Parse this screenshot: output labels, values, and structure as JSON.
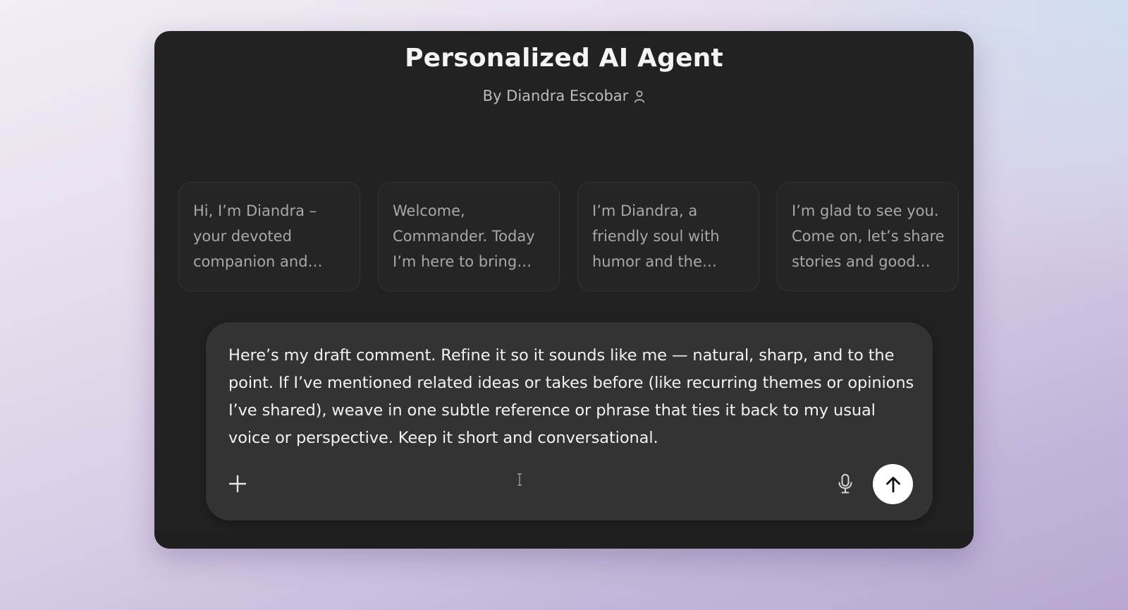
{
  "header": {
    "title": "Personalized AI Agent",
    "byline": "By Diandra Escobar",
    "byline_icon": "person-icon"
  },
  "suggestions": [
    {
      "text": "Hi, I’m Diandra – your devoted companion and…"
    },
    {
      "text": "Welcome, Commander. Today I’m here to bring…"
    },
    {
      "text": "I’m Diandra, a friendly soul with humor and the…"
    },
    {
      "text": "I’m glad to see you. Come on, let’s share stories and good…"
    }
  ],
  "composer": {
    "prompt_text": "Here’s my draft comment. Refine it so it sounds like me — natural, sharp, and to the point. If I’ve mentioned related ideas or takes before (like recurring themes or opinions I’ve shared), weave in one subtle reference or phrase that ties it back to my usual voice or perspective. Keep it short and conversational.",
    "attach_icon": "plus-icon",
    "mic_icon": "microphone-icon",
    "send_icon": "arrow-up-icon"
  },
  "colors": {
    "window_bg": "#222222",
    "composer_bg": "#333333",
    "send_bg": "#ffffff"
  }
}
